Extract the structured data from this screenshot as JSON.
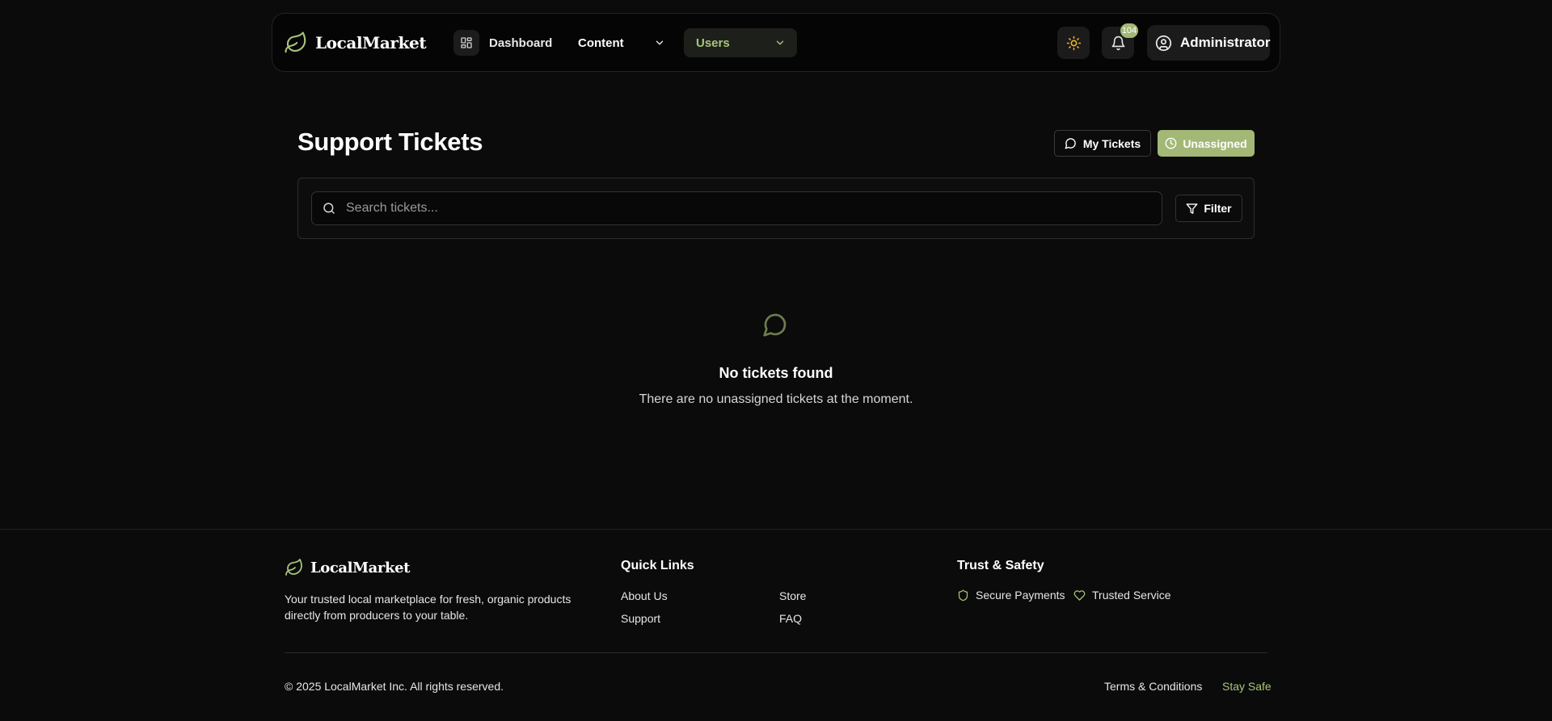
{
  "brand": {
    "name": "LocalMarket",
    "accent": "#a3b876"
  },
  "nav": {
    "dashboard": "Dashboard",
    "content": "Content",
    "users": "Users",
    "notification_count": "104",
    "user_name": "Administrator"
  },
  "main": {
    "title": "Support Tickets",
    "my_tickets": "My Tickets",
    "unassigned": "Unassigned",
    "search_placeholder": "Search tickets...",
    "filter": "Filter",
    "empty_title": "No tickets found",
    "empty_subtitle": "There are no unassigned tickets at the moment."
  },
  "footer": {
    "brand": "LocalMarket",
    "description": "Your trusted local marketplace for fresh, organic products directly from producers to your table.",
    "quick_links_title": "Quick Links",
    "links": [
      "About Us",
      "Support",
      "Store",
      "FAQ"
    ],
    "trust_title": "Trust & Safety",
    "trust_items": [
      "Secure Payments",
      "Trusted Service"
    ],
    "copyright": "© 2025 LocalMarket Inc. All rights reserved.",
    "terms": "Terms & Conditions",
    "stay_safe": "Stay Safe"
  }
}
